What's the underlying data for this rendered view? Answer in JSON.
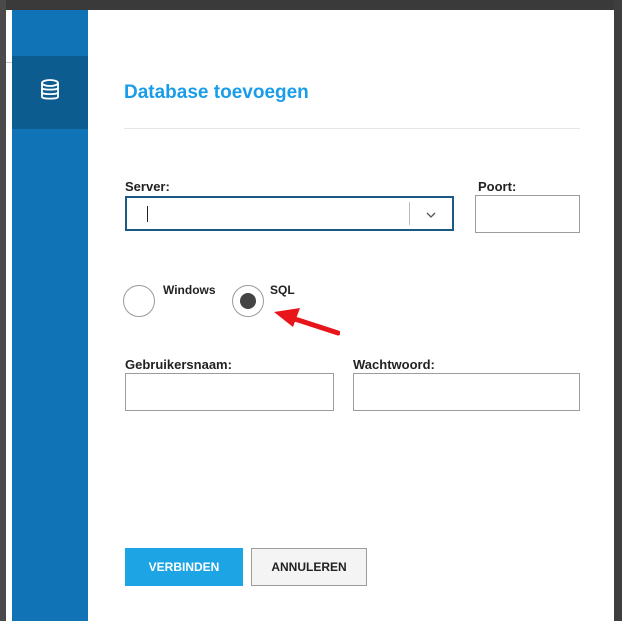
{
  "dialog": {
    "title": "Database toevoegen"
  },
  "sidebar": {
    "items": [
      {
        "icon": "database-icon"
      }
    ]
  },
  "form": {
    "server": {
      "label": "Server:",
      "value": ""
    },
    "port": {
      "label": "Poort:",
      "value": ""
    },
    "auth": {
      "options": [
        {
          "label": "Windows",
          "selected": false
        },
        {
          "label": "SQL",
          "selected": true
        }
      ]
    },
    "username": {
      "label": "Gebruikersnaam:",
      "value": ""
    },
    "password": {
      "label": "Wachtwoord:",
      "value": ""
    }
  },
  "buttons": {
    "connect": "VERBINDEN",
    "cancel": "ANNULEREN"
  },
  "annotation": {
    "arrow_color": "#e8161b"
  },
  "colors": {
    "sidebar": "#0f73b5",
    "sidebar_active": "#0d5c8f",
    "accent": "#1ca4e4",
    "title": "#1a9de8"
  }
}
